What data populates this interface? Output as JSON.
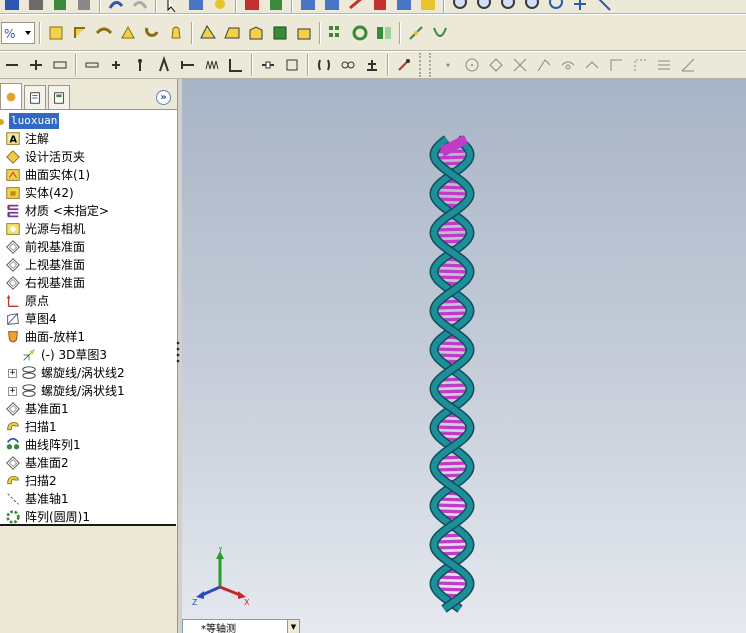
{
  "tree": {
    "root": "luoxuan",
    "items": [
      {
        "label": "注解",
        "icon": "annotation-icon"
      },
      {
        "label": "设计活页夹",
        "icon": "design-binder-icon"
      },
      {
        "label": "曲面实体(1)",
        "icon": "surface-bodies-icon"
      },
      {
        "label": "实体(42)",
        "icon": "solid-bodies-icon"
      },
      {
        "label": "材质 <未指定>",
        "icon": "material-icon"
      },
      {
        "label": "光源与相机",
        "icon": "lights-cameras-icon"
      },
      {
        "label": "前视基准面",
        "icon": "plane-icon"
      },
      {
        "label": "上视基准面",
        "icon": "plane-icon"
      },
      {
        "label": "右视基准面",
        "icon": "plane-icon"
      },
      {
        "label": "原点",
        "icon": "origin-icon"
      },
      {
        "label": "草图4",
        "icon": "sketch-icon"
      },
      {
        "label": "曲面-放样1",
        "icon": "surface-loft-icon"
      },
      {
        "label": "(-) 3D草图3",
        "icon": "sketch3d-icon",
        "indent": 1
      },
      {
        "label": "螺旋线/涡状线2",
        "icon": "helix-icon",
        "indent": 1,
        "expander": "+"
      },
      {
        "label": "螺旋线/涡状线1",
        "icon": "helix-icon",
        "indent": 1,
        "expander": "+"
      },
      {
        "label": "基准面1",
        "icon": "plane-icon"
      },
      {
        "label": "扫描1",
        "icon": "sweep-icon"
      },
      {
        "label": "曲线阵列1",
        "icon": "curve-pattern-icon"
      },
      {
        "label": "基准面2",
        "icon": "plane-icon"
      },
      {
        "label": "扫描2",
        "icon": "sweep-icon"
      },
      {
        "label": "基准轴1",
        "icon": "axis-icon"
      },
      {
        "label": "阵列(圆周)1",
        "icon": "circular-pattern-icon"
      }
    ]
  },
  "viewport": {
    "view_name": "*等轴测",
    "triad": {
      "x": "X",
      "y": "Y",
      "z": "Z"
    }
  },
  "colors": {
    "backbone": "#1e8e9a",
    "rungs": "#c23ac8",
    "selection": "#316ac5"
  }
}
